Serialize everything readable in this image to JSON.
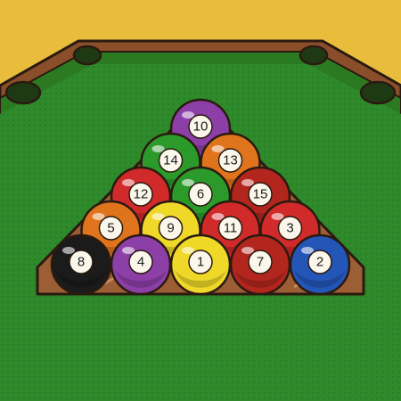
{
  "colors": {
    "background": "#e9bd3c",
    "felt": "#2e8a2a",
    "felt_dark": "#237020",
    "rail_wood": "#8a4f2a",
    "rail_cushion": "#2b7a22",
    "pocket": "#1e3a14",
    "rack_wood": "#9b5e35",
    "outline": "#2a1a10"
  },
  "rack": {
    "balls": [
      {
        "number": "10",
        "color": "#8d3fa8",
        "stripe": true
      },
      {
        "number": "14",
        "color": "#2b9a2b",
        "stripe": true
      },
      {
        "number": "13",
        "color": "#e0741c",
        "stripe": true
      },
      {
        "number": "12",
        "color": "#d12a2a",
        "stripe": true
      },
      {
        "number": "6",
        "color": "#2b9a2b",
        "stripe": false
      },
      {
        "number": "15",
        "color": "#b3261e",
        "stripe": true
      },
      {
        "number": "5",
        "color": "#e0741c",
        "stripe": false
      },
      {
        "number": "9",
        "color": "#f0d828",
        "stripe": true
      },
      {
        "number": "11",
        "color": "#d12a2a",
        "stripe": true
      },
      {
        "number": "3",
        "color": "#d12a2a",
        "stripe": false
      },
      {
        "number": "8",
        "color": "#1b1b1b",
        "stripe": false
      },
      {
        "number": "4",
        "color": "#8d3fa8",
        "stripe": false
      },
      {
        "number": "1",
        "color": "#f0d828",
        "stripe": false
      },
      {
        "number": "7",
        "color": "#b3261e",
        "stripe": false
      },
      {
        "number": "2",
        "color": "#2456b8",
        "stripe": false
      }
    ]
  }
}
